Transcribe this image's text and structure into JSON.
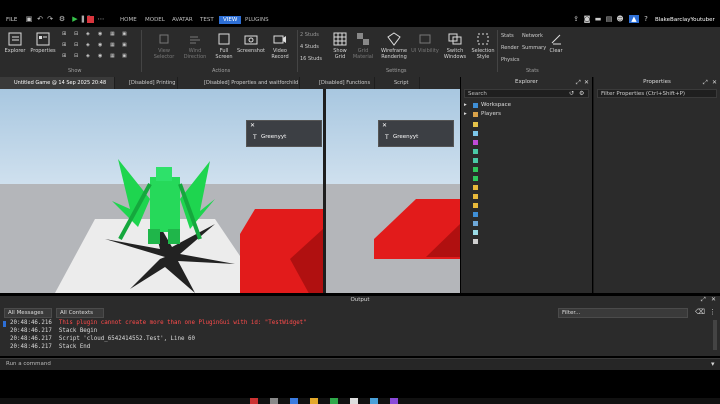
{
  "menu": {
    "file": "FILE",
    "tabs": [
      "HOME",
      "MODEL",
      "AVATAR",
      "TEST",
      "VIEW",
      "PLUGINS"
    ],
    "active_tab": "VIEW",
    "username": "BlakeBarclayYoutuber"
  },
  "ribbon": {
    "explorer": "Explorer",
    "properties": "Properties",
    "show_group": "Show",
    "view_selector": "View Selector",
    "wind_direction": "Wind Direction",
    "full_screen": "Full Screen",
    "screenshot": "Screenshot",
    "video_record": "Video Record",
    "actions_group": "Actions",
    "studs": [
      "2 Studs",
      "4 Studs",
      "16 Studs"
    ],
    "show_grid": "Show Grid",
    "grid_material": "Grid Material",
    "wireframe": "Wireframe Rendering",
    "ui_visibility": "UI Visibility",
    "switch_windows": "Switch Windows",
    "selection_style": "Selection Style",
    "settings_group": "Settings",
    "stats": "Stats",
    "network": "Network",
    "render": "Render",
    "summary": "Summary",
    "physics": "Physics",
    "clear": "Clear",
    "stats_group": "Stats"
  },
  "doc_tabs": [
    "Untitled Game @ 14 Sep 2025 20:48",
    "[Disabled] Printing",
    "[Disabled] Properties and waitforchild",
    "[Disabled] Functions",
    "Script"
  ],
  "viewport": {
    "hud_name_left": "Greenyyt",
    "hud_name_right": "Greenyyt"
  },
  "explorer": {
    "title": "Explorer",
    "search": "Search",
    "items": [
      "Workspace",
      "Players"
    ]
  },
  "properties": {
    "title": "Properties",
    "filter": "Filter Properties (Ctrl+Shift+P)"
  },
  "output": {
    "title": "Output",
    "messages_filter": "All Messages",
    "contexts_filter": "All Contexts",
    "filter_placeholder": "Filter...",
    "lines": [
      {
        "time": "20:48:46.216",
        "text": "This plugin cannot create more than one PluginGui with id: \"TestWidget\"",
        "error": true
      },
      {
        "time": "20:48:46.217",
        "text": "Stack Begin",
        "error": false
      },
      {
        "time": "20:48:46.217",
        "text": "Script 'cloud_6542414552.Test', Line 60",
        "error": false
      },
      {
        "time": "20:48:46.217",
        "text": "Stack End",
        "error": false
      }
    ]
  },
  "command_bar": {
    "placeholder": "Run a command"
  },
  "colors": {
    "accent": "#2d6fd6",
    "error": "#ff4b4b",
    "wall": "#e21b1b"
  }
}
